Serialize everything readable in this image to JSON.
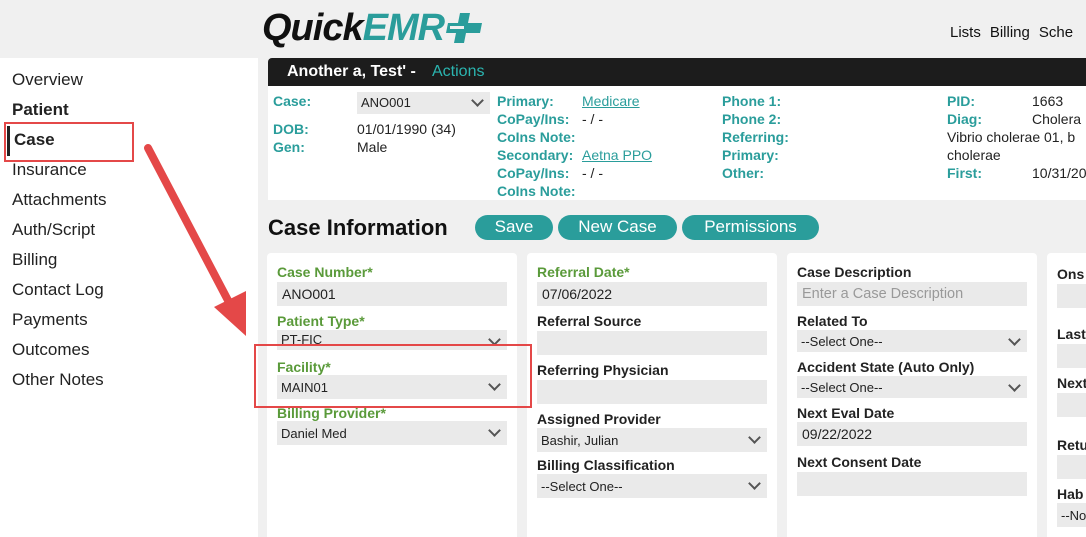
{
  "topbar": {
    "logo_quick": "Quick",
    "logo_emr": "EMR",
    "nav": [
      "Lists",
      "Billing",
      "Sche"
    ]
  },
  "sidebar": {
    "items": [
      {
        "label": "Overview",
        "bold": false
      },
      {
        "label": "Patient",
        "bold": true
      },
      {
        "label": "Case",
        "bold": true
      },
      {
        "label": "Insurance",
        "bold": false
      },
      {
        "label": "Attachments",
        "bold": false
      },
      {
        "label": "Auth/Script",
        "bold": false
      },
      {
        "label": "Billing",
        "bold": false
      },
      {
        "label": "Contact Log",
        "bold": false
      },
      {
        "label": "Payments",
        "bold": false
      },
      {
        "label": "Outcomes",
        "bold": false
      },
      {
        "label": "Other Notes",
        "bold": false
      }
    ]
  },
  "patient": {
    "name": "Another a, Test' -",
    "actions": "Actions",
    "case_label": "Case:",
    "case_value": "ANO001",
    "dob_label": "DOB:",
    "dob_value": "01/01/1990 (34)",
    "gen_label": "Gen:",
    "gen_value": "Male",
    "primary_label": "Primary:",
    "primary_value": "Medicare",
    "copay1_label": "CoPay/Ins:",
    "copay1_value": "- / -",
    "coins1_label": "CoIns Note:",
    "secondary_label": "Secondary:",
    "secondary_value": "Aetna PPO",
    "copay2_label": "CoPay/Ins:",
    "copay2_value": "- / -",
    "coins2_label": "CoIns Note:",
    "phone1_label": "Phone 1:",
    "phone2_label": "Phone 2:",
    "referring_label": "Referring:",
    "primary2_label": "Primary:",
    "other_label": "Other:",
    "pid_label": "PID:",
    "pid_value": "1663",
    "diag_label": "Diag:",
    "diag_value": "Cholera",
    "diag_line2": "Vibrio cholerae 01, b",
    "diag_line3": "cholerae",
    "first_label": "First:",
    "first_value": "10/31/20"
  },
  "case_info": {
    "title": "Case Information",
    "save": "Save",
    "new_case": "New Case",
    "permissions": "Permissions"
  },
  "col1": {
    "case_number_label": "Case Number*",
    "case_number_value": "ANO001",
    "patient_type_label": "Patient Type*",
    "patient_type_value": "PT-FIC",
    "facility_label": "Facility*",
    "facility_value": "MAIN01",
    "billing_provider_label": "Billing Provider*",
    "billing_provider_value": "Daniel Med"
  },
  "col2": {
    "referral_date_label": "Referral Date*",
    "referral_date_value": "07/06/2022",
    "referral_source_label": "Referral Source",
    "referring_physician_label": "Referring Physician",
    "assigned_provider_label": "Assigned Provider",
    "assigned_provider_value": "Bashir, Julian",
    "billing_class_label": "Billing Classification",
    "billing_class_value": "--Select One--"
  },
  "col3": {
    "case_desc_label": "Case Description",
    "case_desc_placeholder": "Enter a Case Description",
    "related_to_label": "Related To",
    "related_to_value": "--Select One--",
    "accident_state_label": "Accident State (Auto Only)",
    "accident_state_value": "--Select One--",
    "next_eval_label": "Next Eval Date",
    "next_eval_value": "09/22/2022",
    "next_consent_label": "Next Consent Date"
  },
  "col4": {
    "onset_label": "Ons",
    "last_label": "Last",
    "next_label": "Next",
    "return_label": "Retu",
    "hab_label": "Hab",
    "hab_value": "--No"
  },
  "colors": {
    "accent": "#2a9d9b",
    "highlight": "#e44848",
    "green_label": "#5a9a3a"
  }
}
